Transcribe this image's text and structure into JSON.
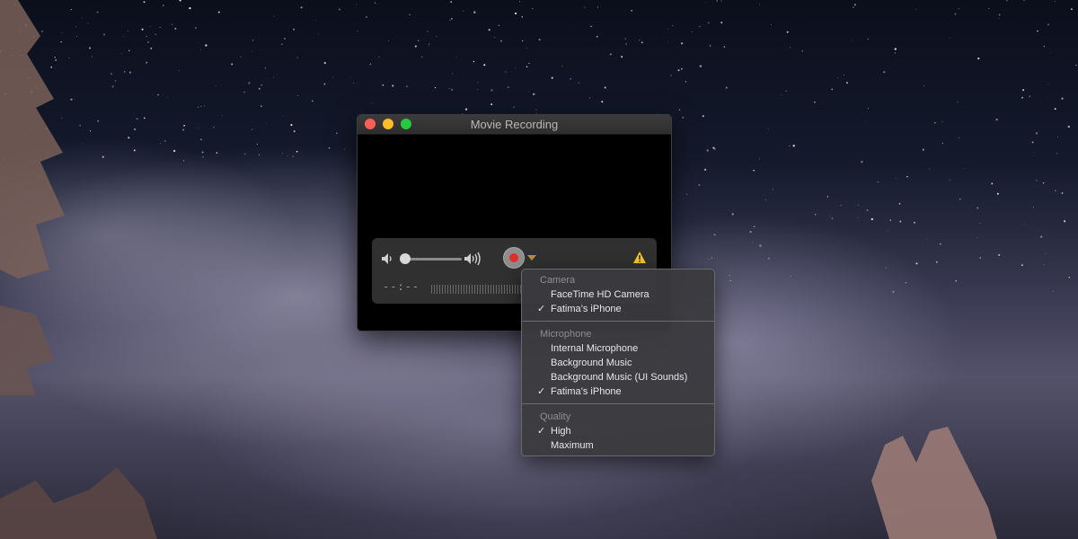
{
  "window": {
    "title": "Movie Recording",
    "elapsed_time": "--:--",
    "volume_level": 0.05
  },
  "menu": {
    "sections": [
      {
        "header": "Camera",
        "items": [
          {
            "label": "FaceTime HD Camera",
            "check": ""
          },
          {
            "label": "Fatima’s iPhone",
            "check": "✓"
          }
        ]
      },
      {
        "header": "Microphone",
        "items": [
          {
            "label": "Internal Microphone",
            "check": ""
          },
          {
            "label": "Background Music",
            "check": ""
          },
          {
            "label": "Background Music (UI Sounds)",
            "check": ""
          },
          {
            "label": "Fatima’s iPhone",
            "check": "✓"
          }
        ]
      },
      {
        "header": "Quality",
        "items": [
          {
            "label": "High",
            "check": "✓"
          },
          {
            "label": "Maximum",
            "check": ""
          }
        ]
      }
    ]
  },
  "colors": {
    "record_red": "#e0302a",
    "warning_yellow": "#f4c430",
    "close": "#fc5f57",
    "minimize": "#fdbc2e",
    "maximize": "#28c840"
  },
  "icons": [
    "volume-low-icon",
    "volume-high-icon",
    "record-icon",
    "chevron-down-icon",
    "warning-icon"
  ]
}
